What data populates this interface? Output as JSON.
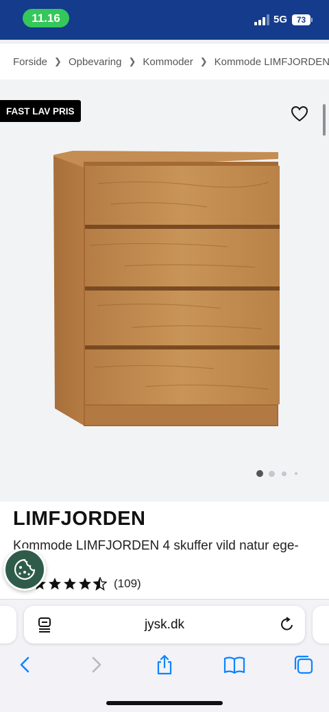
{
  "status": {
    "time": "11.16",
    "network": "5G",
    "battery": "73"
  },
  "breadcrumb": [
    "Forside",
    "Opbevaring",
    "Kommoder",
    "Kommode LIMFJORDEN"
  ],
  "product": {
    "badge": "FAST LAV PRIS",
    "title": "LIMFJORDEN",
    "subtitle": "Kommode LIMFJORDEN 4 skuffer vild natur ege-",
    "rating": 4.5,
    "review_count": "(109)",
    "image_count": 4,
    "active_image": 1
  },
  "browser": {
    "url": "jysk.dk"
  },
  "colors": {
    "status_bar": "#143b8c",
    "time_pill": "#34c759",
    "cookie_button": "#2f5c4a",
    "safari_blue": "#0a84ff"
  },
  "icons": [
    "signal-icon",
    "battery-icon",
    "heart-icon",
    "cookie-icon",
    "reader-icon",
    "reload-icon",
    "back-icon",
    "forward-icon",
    "share-icon",
    "bookmarks-icon",
    "tabs-icon"
  ]
}
